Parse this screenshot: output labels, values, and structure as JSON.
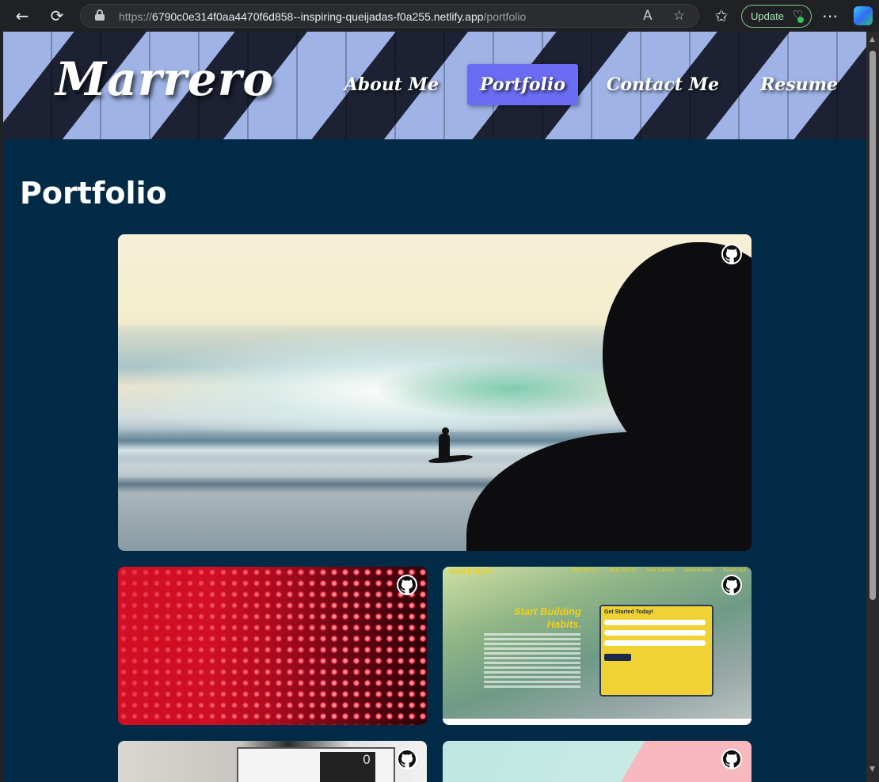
{
  "browser": {
    "url_prefix": "https://",
    "url_host": "6790c0e314f0aa4470f6d858--inspiring-queijadas-f0a255.netlify.app",
    "url_path": "/portfolio",
    "update_label": "Update",
    "back_icon": "←",
    "reload_icon": "⟳",
    "read_aloud_icon": "A",
    "favorite_icon": "☆",
    "favorites_icon": "✩",
    "more_icon": "⋯"
  },
  "site": {
    "logo": "Marrero",
    "nav": [
      {
        "label": "About Me",
        "active": false
      },
      {
        "label": "Portfolio",
        "active": true
      },
      {
        "label": "Contact Me",
        "active": false
      },
      {
        "label": "Resume",
        "active": false
      }
    ]
  },
  "page": {
    "title": "Portfolio"
  },
  "run_buddy": {
    "logo": "RUN BUDDY",
    "nav": [
      "What We Do",
      "What You Do",
      "Your Trainers",
      "Service Plans",
      "Reach Out"
    ],
    "headline": "Start Building Habits.",
    "form_title": "Get Started Today!",
    "form_button": "Get running!"
  },
  "code_card": {
    "display_digit": "0"
  },
  "colors": {
    "background": "#002a45",
    "nav_active": "#6a6df3"
  }
}
